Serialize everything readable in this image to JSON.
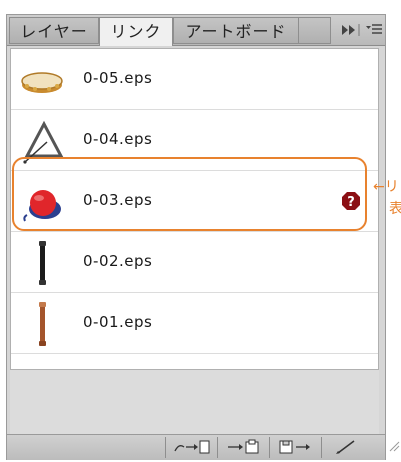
{
  "tabs": [
    {
      "label": "レイヤー",
      "active": false
    },
    {
      "label": "リンク",
      "active": true
    },
    {
      "label": "アートボード",
      "active": false
    }
  ],
  "links": [
    {
      "name": "0-05.eps",
      "thumb": "tambourine-icon",
      "missing": false
    },
    {
      "name": "0-04.eps",
      "thumb": "triangle-instrument-icon",
      "missing": false
    },
    {
      "name": "0-03.eps",
      "thumb": "castanets-icon",
      "missing": true
    },
    {
      "name": "0-02.eps",
      "thumb": "recorder-black-icon",
      "missing": false
    },
    {
      "name": "0-01.eps",
      "thumb": "recorder-brown-icon",
      "missing": false
    }
  ],
  "annotation": {
    "line1": "←リ",
    "line2": "表"
  },
  "colors": {
    "highlight": "#e8822e",
    "warning": "#8b0f14"
  },
  "toolbar_icons": [
    "relink-icon",
    "go-to-link-icon",
    "update-link-icon",
    "edit-original-icon"
  ]
}
